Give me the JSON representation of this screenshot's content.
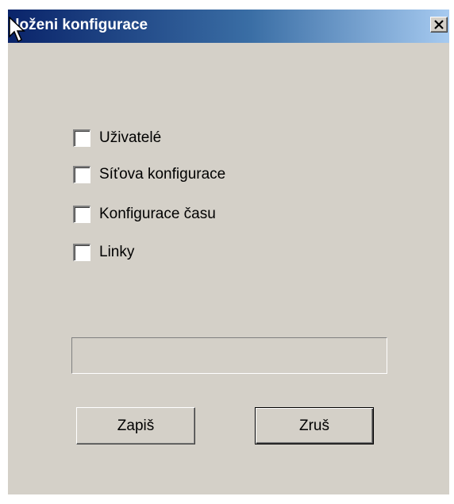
{
  "window": {
    "title": "Uložení konfigurace",
    "title_display": " loženi konfigurace",
    "close_icon": "close-icon"
  },
  "options": [
    {
      "label": "Uživatelé",
      "checked": false
    },
    {
      "label": "Síťova konfigurace",
      "checked": false
    },
    {
      "label": "Konfigurace času",
      "checked": false
    },
    {
      "label": "Linky",
      "checked": false
    }
  ],
  "progress": {
    "value": 0
  },
  "buttons": {
    "save_label": "Zapiš",
    "cancel_label": "Zruš"
  },
  "colors": {
    "face": "#d4d0c8",
    "title_start": "#0a246a",
    "title_end": "#a6caf0"
  }
}
